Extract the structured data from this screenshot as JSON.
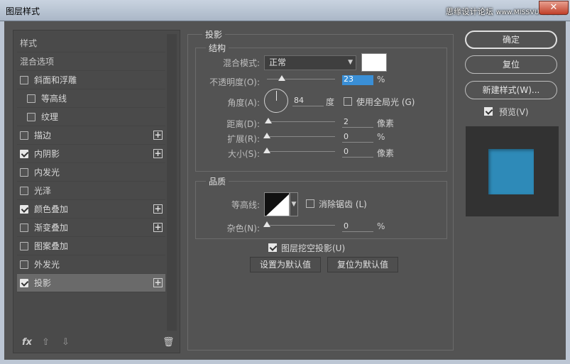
{
  "window": {
    "title": "图层样式",
    "watermark": "思缘设计论坛",
    "watermark_url": "www.MISSVUAN.COM",
    "close_glyph": "✕"
  },
  "style_list": {
    "header_styles": "样式",
    "header_blend": "混合选项",
    "items": [
      {
        "label": "斜面和浮雕",
        "checked": false,
        "plus": false,
        "indent": false
      },
      {
        "label": "等高线",
        "checked": false,
        "plus": false,
        "indent": true
      },
      {
        "label": "纹理",
        "checked": false,
        "plus": false,
        "indent": true
      },
      {
        "label": "描边",
        "checked": false,
        "plus": true,
        "indent": false
      },
      {
        "label": "内阴影",
        "checked": true,
        "plus": true,
        "indent": false
      },
      {
        "label": "内发光",
        "checked": false,
        "plus": false,
        "indent": false
      },
      {
        "label": "光泽",
        "checked": false,
        "plus": false,
        "indent": false
      },
      {
        "label": "颜色叠加",
        "checked": true,
        "plus": true,
        "indent": false
      },
      {
        "label": "渐变叠加",
        "checked": false,
        "plus": true,
        "indent": false
      },
      {
        "label": "图案叠加",
        "checked": false,
        "plus": false,
        "indent": false
      },
      {
        "label": "外发光",
        "checked": false,
        "plus": false,
        "indent": false
      },
      {
        "label": "投影",
        "checked": true,
        "plus": true,
        "indent": false,
        "selected": true
      }
    ],
    "fx_label": "fx",
    "up_glyph": "⇧",
    "down_glyph": "⇩",
    "trash_glyph": "🗑"
  },
  "drop_shadow": {
    "title": "投影",
    "structure": {
      "title": "结构",
      "blend_mode_label": "混合模式:",
      "blend_mode_value": "正常",
      "color": "#ffffff",
      "opacity_label": "不透明度(O):",
      "opacity_value": "23",
      "opacity_unit": "%",
      "angle_label": "角度(A):",
      "angle_value": "84",
      "angle_unit": "度",
      "global_light_label": "使用全局光 (G)",
      "global_light_checked": false,
      "distance_label": "距离(D):",
      "distance_value": "2",
      "distance_unit": "像素",
      "spread_label": "扩展(R):",
      "spread_value": "0",
      "spread_unit": "%",
      "size_label": "大小(S):",
      "size_value": "0",
      "size_unit": "像素"
    },
    "quality": {
      "title": "品质",
      "contour_label": "等高线:",
      "antialias_label": "消除锯齿 (L)",
      "antialias_checked": false,
      "noise_label": "杂色(N):",
      "noise_value": "0",
      "noise_unit": "%"
    },
    "knockout_label": "图层挖空投影(U)",
    "knockout_checked": true,
    "set_default_label": "设置为默认值",
    "reset_default_label": "复位为默认值"
  },
  "right": {
    "ok_label": "确定",
    "reset_label": "复位",
    "new_style_label": "新建样式(W)...",
    "preview_label": "预览(V)",
    "preview_checked": true,
    "preview_color": "#2e8ab8"
  }
}
